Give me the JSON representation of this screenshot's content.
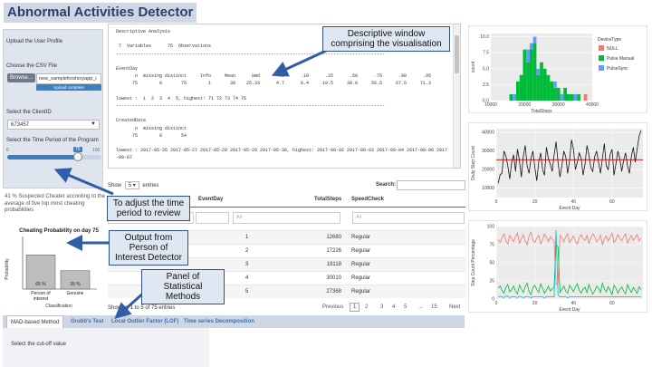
{
  "app": {
    "title": "Abnormal Activities Detector"
  },
  "sidebar": {
    "upload_profile_label": "Upload the User Profile",
    "csv_label": "Choose the CSV File",
    "browse_label": "Browse...",
    "file_name": "new_sampleforshinyapp_i",
    "upload_status": "Upload complete",
    "client_label": "Select the ClientID",
    "client_value": "673457",
    "period_label": "Select the Time Period of the Program",
    "slider_min_label": "0",
    "slider_value_label": "75",
    "slider_max_label": "100",
    "slider_fraction": 0.75
  },
  "result_text": "41 % Suspected Cheater according to the average of five top most cheating probabilities",
  "prob_chart": {
    "title": "Cheating Probability on day 75",
    "ylabel": "Probability",
    "xlabel": "Classification",
    "bars": [
      {
        "label_line1": "Person of",
        "label_line2": "interest",
        "value": 65,
        "value_label": "65 %"
      },
      {
        "label_line1": "Genuine",
        "label_line2": "",
        "value": 35,
        "value_label": "35 %"
      }
    ]
  },
  "descriptive": {
    "lines": [
      "Descriptive Analysis",
      "",
      " 7  Variables      75  Observations",
      "---------------------------------------------------------------------------------------------------",
      "",
      "EventDay",
      "       n  missing distinct     Info     Mean      Gmd      .05      .10      .25      .50      .75      .90      .95",
      "      75        0       75        1       38    25.33      4.7      8.4     19.5     38.0     56.5     67.6     71.3",
      "",
      "lowest :  1  2  3  4  5, highest: 71 72 73 74 75",
      "---------------------------------------------------------------------------------------------------",
      "",
      "CreatedDate",
      "       n  missing distinct",
      "      75        0       54",
      "",
      "lowest : 2017-05-26 2017-05-27 2017-05-28 2017-05-29 2017-05-30, highest: 2017-08-02 2017-08-03 2017-08-04 2017-08-06 2017",
      "-08-07"
    ]
  },
  "callouts": {
    "descriptive": "Descriptive window comprising the visualisation",
    "adjust": "To adjust the time period to review",
    "output": "Output from Person of Interest Detector",
    "panel": "Panel of Statistical Methods"
  },
  "table": {
    "show_label": "Show",
    "show_value": "5",
    "entries_label": "entries",
    "search_label": "Search:",
    "columns": [
      "",
      "EventDay",
      "TotalSteps",
      "SpeedCheck"
    ],
    "filter_placeholders": [
      "",
      "All",
      "All",
      "All"
    ],
    "rows": [
      [
        "",
        "1",
        "12680",
        "Regular"
      ],
      [
        "",
        "2",
        "17226",
        "Regular"
      ],
      [
        "",
        "3",
        "18118",
        "Regular"
      ],
      [
        "",
        "4",
        "30010",
        "Regular"
      ],
      [
        "",
        "5",
        "27368",
        "Regular"
      ]
    ],
    "info": "Showing 1 to 5 of 75 entries",
    "pagination": [
      "Previous",
      "1",
      "2",
      "3",
      "4",
      "5",
      "...",
      "15",
      "Next"
    ]
  },
  "method_tabs": [
    "MAD-based Method",
    "Grubb's Test",
    "Local Outlier Factor (LOF)",
    "Time series Decomposition"
  ],
  "cutoff_label": "Select the cut-off value",
  "colors": {
    "null": "#f8766d",
    "pulse_manual": "#00ba38",
    "pulse_sync": "#619cff",
    "reference": "#cc0000"
  },
  "chart_data": [
    {
      "type": "bar",
      "subtype": "stacked-histogram",
      "title": "",
      "xlabel": "TotalSteps",
      "ylabel": "count",
      "xlim": [
        10000,
        40000
      ],
      "ylim": [
        0,
        10.5
      ],
      "x_ticks": [
        "10000",
        "20000",
        "30000",
        "40000"
      ],
      "y_ticks": [
        "0.0",
        "2.5",
        "5.0",
        "7.5",
        "10.0"
      ],
      "legend_title": "DeviceType",
      "legend_position": "right",
      "categories": [
        16000,
        17000,
        18000,
        19000,
        20000,
        21000,
        22000,
        23000,
        24000,
        25000,
        26000,
        27000,
        28000,
        29000,
        30000,
        31000,
        32000,
        33000,
        34000,
        35000,
        36000,
        37000,
        38000,
        39000
      ],
      "series": [
        {
          "name": "NULL",
          "values": [
            0,
            0,
            0,
            0,
            0,
            0,
            0,
            0,
            0,
            0,
            0,
            0,
            0,
            0,
            0,
            0,
            0,
            0,
            0,
            0,
            0,
            0,
            1,
            0
          ]
        },
        {
          "name": "Pulse Manual",
          "values": [
            1,
            0,
            3,
            4,
            8,
            6,
            8,
            9,
            4,
            6,
            5,
            4,
            3,
            2,
            2,
            0,
            2,
            1,
            1,
            0,
            1,
            0,
            0,
            0
          ]
        },
        {
          "name": "PulseSync",
          "values": [
            0,
            1,
            0,
            0,
            0,
            2,
            1,
            1,
            1,
            0,
            0,
            0,
            0,
            1,
            0,
            1,
            0,
            0,
            0,
            1,
            0,
            0,
            0,
            0
          ]
        }
      ]
    },
    {
      "type": "line",
      "title": "",
      "xlabel": "Event Day",
      "ylabel": "Daily Step Count",
      "xlim": [
        0,
        76
      ],
      "ylim": [
        5000,
        42000
      ],
      "x_ticks": [
        "0",
        "20",
        "40",
        "60"
      ],
      "y_ticks": [
        "10000",
        "20000",
        "30000",
        "40000"
      ],
      "reference_line": 25300,
      "x": [
        1,
        2,
        3,
        4,
        5,
        6,
        7,
        8,
        9,
        10,
        11,
        12,
        13,
        14,
        15,
        16,
        17,
        18,
        19,
        20,
        21,
        22,
        23,
        24,
        25,
        26,
        27,
        28,
        29,
        30,
        31,
        32,
        33,
        34,
        35,
        36,
        37,
        38,
        39,
        40,
        41,
        42,
        43,
        44,
        45,
        46,
        47,
        48,
        49,
        50,
        51,
        52,
        53,
        54,
        55,
        56,
        57,
        58,
        59,
        60,
        61,
        62,
        63,
        64,
        65,
        66,
        67,
        68,
        69,
        70,
        71,
        72,
        73,
        74,
        75
      ],
      "series": [
        {
          "values": [
            12680,
            17226,
            18118,
            30010,
            27368,
            22000,
            15000,
            24000,
            28000,
            19000,
            31000,
            25000,
            16000,
            27000,
            33000,
            22000,
            18000,
            26000,
            30000,
            21000,
            14000,
            24000,
            29000,
            20000,
            17000,
            32000,
            26000,
            23000,
            19000,
            28000,
            35000,
            24000,
            16000,
            22000,
            30000,
            27000,
            18000,
            25000,
            36000,
            31000,
            20000,
            24000,
            29000,
            26000,
            17000,
            23000,
            33000,
            28000,
            21000,
            19000,
            27000,
            30000,
            24000,
            18000,
            26000,
            34000,
            22000,
            20000,
            28000,
            31000,
            17000,
            23000,
            30000,
            26000,
            19000,
            25000,
            29000,
            22000,
            18000,
            27000,
            32000,
            24000,
            31000,
            38000,
            41000
          ]
        }
      ]
    },
    {
      "type": "line",
      "title": "",
      "xlabel": "Event Day",
      "ylabel": "Step Count Percentage",
      "xlim": [
        0,
        76
      ],
      "ylim": [
        0,
        100
      ],
      "x_ticks": [
        "0",
        "20",
        "40",
        "60"
      ],
      "y_ticks": [
        "0",
        "25",
        "50",
        "75",
        "100"
      ],
      "x": [
        1,
        2,
        3,
        4,
        5,
        6,
        7,
        8,
        9,
        10,
        11,
        12,
        13,
        14,
        15,
        16,
        17,
        18,
        19,
        20,
        21,
        22,
        23,
        24,
        25,
        26,
        27,
        28,
        29,
        30,
        31,
        32,
        33,
        34,
        35,
        36,
        37,
        38,
        39,
        40,
        41,
        42,
        43,
        44,
        45,
        46,
        47,
        48,
        49,
        50,
        51,
        52,
        53,
        54,
        55,
        56,
        57,
        58,
        59,
        60,
        61,
        62,
        63,
        64,
        65,
        66,
        67,
        68,
        69,
        70,
        71,
        72,
        73,
        74,
        75
      ],
      "series": [
        {
          "values": [
            82,
            78,
            85,
            90,
            80,
            76,
            88,
            84,
            79,
            86,
            91,
            77,
            83,
            89,
            80,
            75,
            87,
            92,
            81,
            78,
            84,
            88,
            76,
            82,
            90,
            85,
            79,
            86,
            83,
            80,
            20,
            22,
            88,
            84,
            79,
            86,
            90,
            78,
            82,
            87,
            80,
            76,
            85,
            89,
            83,
            81,
            88,
            77,
            84,
            90,
            86,
            79,
            82,
            88,
            75,
            83,
            87,
            80,
            85,
            91,
            78,
            82,
            89,
            84,
            80,
            86,
            90,
            77,
            83,
            88,
            81,
            85,
            89,
            80,
            84
          ]
        },
        {
          "values": [
            15,
            18,
            12,
            8,
            16,
            20,
            10,
            13,
            18,
            11,
            7,
            19,
            14,
            9,
            17,
            22,
            10,
            6,
            16,
            19,
            13,
            9,
            21,
            15,
            8,
            12,
            18,
            11,
            14,
            17,
            75,
            72,
            9,
            13,
            18,
            11,
            8,
            19,
            15,
            10,
            17,
            21,
            12,
            8,
            14,
            16,
            9,
            20,
            13,
            7,
            11,
            18,
            15,
            9,
            22,
            14,
            10,
            17,
            12,
            6,
            19,
            15,
            8,
            13,
            17,
            11,
            7,
            20,
            14,
            9,
            16,
            12,
            8,
            17,
            13
          ]
        },
        {
          "values": [
            3,
            4,
            3,
            2,
            4,
            4,
            2,
            3,
            3,
            3,
            2,
            4,
            3,
            2,
            3,
            3,
            3,
            2,
            3,
            3,
            3,
            3,
            3,
            3,
            2,
            3,
            3,
            3,
            3,
            3,
            95,
            6,
            3,
            3,
            3,
            3,
            2,
            3,
            3,
            3,
            3,
            3,
            3,
            3,
            3,
            3,
            3,
            3,
            3,
            3,
            3,
            3,
            3,
            3,
            3,
            3,
            3,
            3,
            3,
            3,
            3,
            3,
            3,
            3,
            3,
            3,
            3,
            3,
            3,
            3,
            3,
            3,
            3,
            3,
            3
          ]
        }
      ]
    }
  ]
}
